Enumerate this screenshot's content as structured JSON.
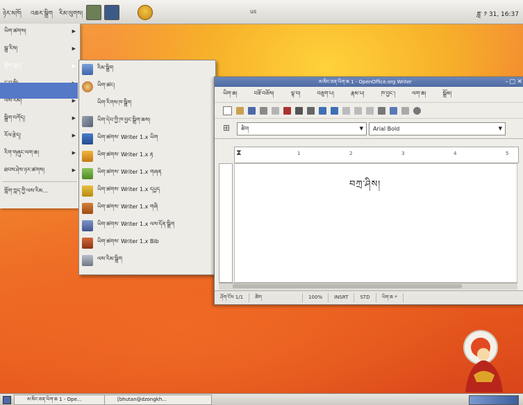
{
  "panel": {
    "menus": [
      "ཉེར་མཁོ།",
      "འཆར་སྒྲིག",
      "རིམ་ལུགས།"
    ],
    "title": "us",
    "clock": "ཟླ་ ༡ 31, 16:37"
  },
  "apps_menu": {
    "items": [
      {
        "label": "ཡིག་ཚགས།"
      },
      {
        "label": "སྒྲ་རིས།"
      },
      {
        "label": "གློག་ཀླད།"
      },
      {
        "label": "དྲ་བ་སྤྱི།"
      },
      {
        "label": "ལས་རིམ།"
      },
      {
        "label": "སྒྲིག་བཀོད།"
      },
      {
        "label": "རོལ་རྩེད།"
      },
      {
        "label": "རིག་གཞུང་ལག་ཆ།"
      },
      {
        "label": "ཐབས་ཤེས་ཉར་ཚགས།"
      }
    ],
    "footer": "གློག་ཀླད་ཀྱི་ལས་རིམ..."
  },
  "submenu": {
    "items": [
      {
        "label": "རིམ་སྒྲིག"
      },
      {
        "label": "ཡིག་ཚང།"
      },
      {
        "label": "ཡིག་རིགས་ཁ་སྒྲིག"
      },
      {
        "label": "ཡིག་དེབ་ཀྱི་ཁ་བྱང་སྒྲིག་ཆས།"
      },
      {
        "label": "ཡིག་ཚགས་ Writer 1.x ཡིག"
      },
      {
        "label": "ཡིག་ཚགས་ Writer 1.x རྟ"
      },
      {
        "label": "ཡིག་ཚགས་ Writer 1.x གཞན"
      },
      {
        "label": "ཡིག་ཚགས་ Writer 1.x དཔྱད"
      },
      {
        "label": "ཡིག་ཚགས་ Writer 1.x གཞི"
      },
      {
        "label": "ཡིག་ཚགས་ Writer 1.x ལས་དོན་སྒྲིག"
      },
      {
        "label": "ཡིག་ཚགས་ Writer 1.x Bib"
      },
      {
        "label": "ལས་རིམ་སྒྲིག"
      }
    ]
  },
  "writer": {
    "title": "མ་མིང་ཅན་ཡིག་ཆ 1 - OpenOffice.org Writer",
    "menus": [
      "ཡིག་ཆ།",
      "བཟོ་བཅོས།",
      "ལྟ་བ།",
      "བཅུག་པ།",
      "རྣམ་པ།",
      "ཁ་བྱང་།",
      "ལག་ཆ།",
      "སྒྲོམ།"
    ],
    "style_value": "ཚིག",
    "font_value": "Arial Bold",
    "ruler_marks": [
      "1",
      "2",
      "3",
      "4",
      "5"
    ],
    "doc_text": "བཀྲ་ཤིས།",
    "status": {
      "page": "ཤོག་ངོས 1/1",
      "style": "ཚིག",
      "zoom": "100%",
      "insert": "INSRT",
      "std": "STD",
      "extra": "ཡིག་ཆ *"
    }
  },
  "taskbar": {
    "items": [
      {
        "label": "མ་མིང་ཅན་ཡིག་ཆ 1 - Ope..."
      },
      {
        "label": "[bhutan@dzongkh..."
      }
    ]
  },
  "colors": {
    "accent": "#5578c7",
    "desktop_orange": "#f07a2a",
    "panel": "#e6e4de"
  }
}
